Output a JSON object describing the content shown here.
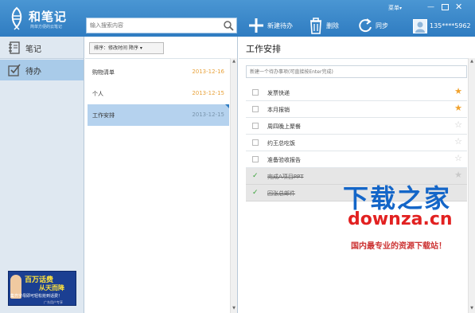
{
  "app": {
    "name": "和笔记",
    "slogan": "简单方便的云笔记"
  },
  "search": {
    "placeholder": "输入搜索内容"
  },
  "toolbar": {
    "new_todo": "新建待办",
    "delete": "删除",
    "sync": "同步"
  },
  "window": {
    "menu": "菜单"
  },
  "user": {
    "phone": "135****5962"
  },
  "sidebar": {
    "items": [
      {
        "label": "笔记",
        "icon": "notebook-icon",
        "active": false
      },
      {
        "label": "待办",
        "icon": "todo-checklist-icon",
        "active": true
      }
    ]
  },
  "ad": {
    "line1": "百万话费",
    "line2": "从天而降",
    "line3": "集齐字母即可轻松抢到话费！",
    "line4": "广东用户专享"
  },
  "notelist": {
    "sort_label": "排序：修改时间 降序",
    "items": [
      {
        "title": "购物清单",
        "date": "2013-12-16",
        "selected": false
      },
      {
        "title": "个人",
        "date": "2013-12-15",
        "selected": false
      },
      {
        "title": "工作安排",
        "date": "2013-12-15",
        "selected": true
      }
    ]
  },
  "detail": {
    "title": "工作安排",
    "input_placeholder": "新建一个待办事项(可直接按Enter完成)",
    "todos": [
      {
        "text": "发票快递",
        "done": false,
        "starred": true
      },
      {
        "text": "本月报销",
        "done": false,
        "starred": true
      },
      {
        "text": "周四晚上聚餐",
        "done": false,
        "starred": false
      },
      {
        "text": "约王总吃饭",
        "done": false,
        "starred": false
      },
      {
        "text": "准备验收报告",
        "done": false,
        "starred": false
      },
      {
        "text": "完成A项目PPT",
        "done": true,
        "starred": true
      },
      {
        "text": "回张总邮件",
        "done": true,
        "starred": false
      }
    ]
  },
  "watermark": {
    "line1": "下载之家",
    "line2": "downza.cn",
    "line3": "国内最专业的资源下载站！"
  },
  "colors": {
    "titlebar": "#3a88c9",
    "accent": "#2f7cc1",
    "star_on": "#f1a22d",
    "date": "#e8a33d"
  }
}
